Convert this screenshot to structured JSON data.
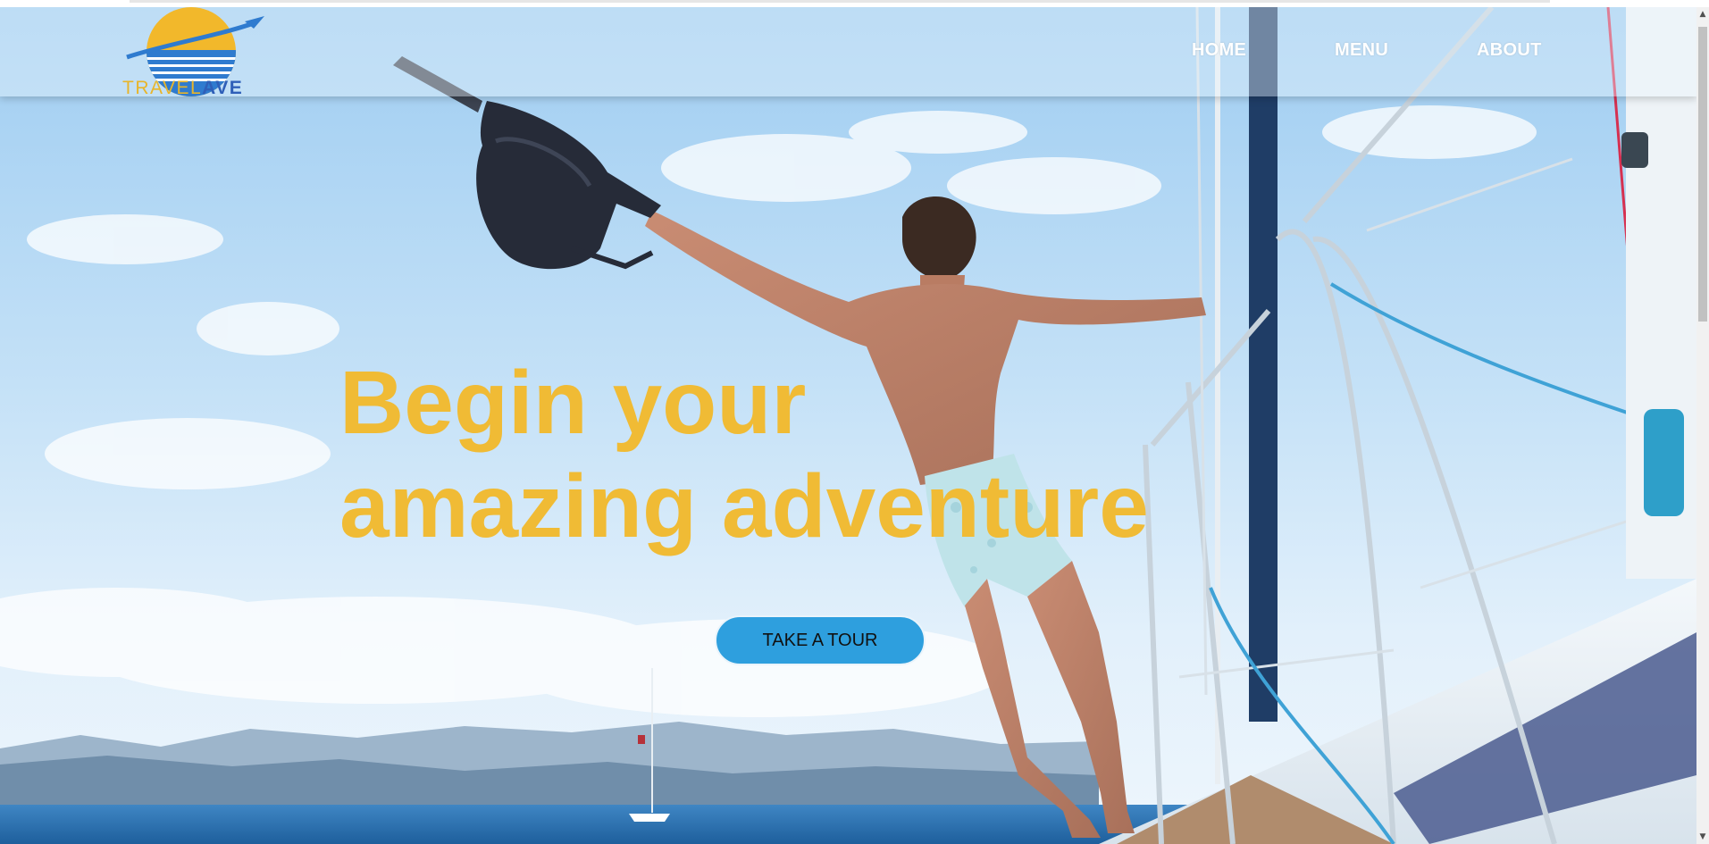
{
  "logo": {
    "word1": "TRAVEL",
    "word2": "AVE",
    "colors": {
      "sun": "#f2b82b",
      "ocean": "#2f7bcf",
      "text_primary": "#e8b52a",
      "text_secondary": "#2f5fb8"
    },
    "icon": "plane-over-sun-logo"
  },
  "nav": {
    "home": "HOME",
    "menu": "MENU",
    "about": "ABOUT"
  },
  "hero": {
    "headline_line1": "Begin your",
    "headline_line2": "amazing adventure",
    "cta_label": "TAKE A TOUR",
    "image": "man-leaping-off-sailboat-holding-backpack-over-sea",
    "colors": {
      "headline": "#f0bb35",
      "cta_background": "#2e9fde"
    }
  },
  "scrollbar": {
    "up_icon": "scroll-up-arrow-icon",
    "down_icon": "scroll-down-arrow-icon"
  }
}
